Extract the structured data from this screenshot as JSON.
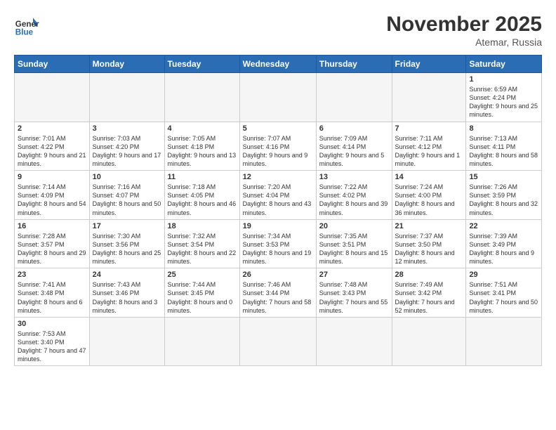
{
  "header": {
    "logo_general": "General",
    "logo_blue": "Blue",
    "month": "November 2025",
    "location": "Atemar, Russia"
  },
  "weekdays": [
    "Sunday",
    "Monday",
    "Tuesday",
    "Wednesday",
    "Thursday",
    "Friday",
    "Saturday"
  ],
  "weeks": [
    [
      {
        "day": "",
        "info": ""
      },
      {
        "day": "",
        "info": ""
      },
      {
        "day": "",
        "info": ""
      },
      {
        "day": "",
        "info": ""
      },
      {
        "day": "",
        "info": ""
      },
      {
        "day": "",
        "info": ""
      },
      {
        "day": "1",
        "info": "Sunrise: 6:59 AM\nSunset: 4:24 PM\nDaylight: 9 hours and 25 minutes."
      }
    ],
    [
      {
        "day": "2",
        "info": "Sunrise: 7:01 AM\nSunset: 4:22 PM\nDaylight: 9 hours and 21 minutes."
      },
      {
        "day": "3",
        "info": "Sunrise: 7:03 AM\nSunset: 4:20 PM\nDaylight: 9 hours and 17 minutes."
      },
      {
        "day": "4",
        "info": "Sunrise: 7:05 AM\nSunset: 4:18 PM\nDaylight: 9 hours and 13 minutes."
      },
      {
        "day": "5",
        "info": "Sunrise: 7:07 AM\nSunset: 4:16 PM\nDaylight: 9 hours and 9 minutes."
      },
      {
        "day": "6",
        "info": "Sunrise: 7:09 AM\nSunset: 4:14 PM\nDaylight: 9 hours and 5 minutes."
      },
      {
        "day": "7",
        "info": "Sunrise: 7:11 AM\nSunset: 4:12 PM\nDaylight: 9 hours and 1 minute."
      },
      {
        "day": "8",
        "info": "Sunrise: 7:13 AM\nSunset: 4:11 PM\nDaylight: 8 hours and 58 minutes."
      }
    ],
    [
      {
        "day": "9",
        "info": "Sunrise: 7:14 AM\nSunset: 4:09 PM\nDaylight: 8 hours and 54 minutes."
      },
      {
        "day": "10",
        "info": "Sunrise: 7:16 AM\nSunset: 4:07 PM\nDaylight: 8 hours and 50 minutes."
      },
      {
        "day": "11",
        "info": "Sunrise: 7:18 AM\nSunset: 4:05 PM\nDaylight: 8 hours and 46 minutes."
      },
      {
        "day": "12",
        "info": "Sunrise: 7:20 AM\nSunset: 4:04 PM\nDaylight: 8 hours and 43 minutes."
      },
      {
        "day": "13",
        "info": "Sunrise: 7:22 AM\nSunset: 4:02 PM\nDaylight: 8 hours and 39 minutes."
      },
      {
        "day": "14",
        "info": "Sunrise: 7:24 AM\nSunset: 4:00 PM\nDaylight: 8 hours and 36 minutes."
      },
      {
        "day": "15",
        "info": "Sunrise: 7:26 AM\nSunset: 3:59 PM\nDaylight: 8 hours and 32 minutes."
      }
    ],
    [
      {
        "day": "16",
        "info": "Sunrise: 7:28 AM\nSunset: 3:57 PM\nDaylight: 8 hours and 29 minutes."
      },
      {
        "day": "17",
        "info": "Sunrise: 7:30 AM\nSunset: 3:56 PM\nDaylight: 8 hours and 25 minutes."
      },
      {
        "day": "18",
        "info": "Sunrise: 7:32 AM\nSunset: 3:54 PM\nDaylight: 8 hours and 22 minutes."
      },
      {
        "day": "19",
        "info": "Sunrise: 7:34 AM\nSunset: 3:53 PM\nDaylight: 8 hours and 19 minutes."
      },
      {
        "day": "20",
        "info": "Sunrise: 7:35 AM\nSunset: 3:51 PM\nDaylight: 8 hours and 15 minutes."
      },
      {
        "day": "21",
        "info": "Sunrise: 7:37 AM\nSunset: 3:50 PM\nDaylight: 8 hours and 12 minutes."
      },
      {
        "day": "22",
        "info": "Sunrise: 7:39 AM\nSunset: 3:49 PM\nDaylight: 8 hours and 9 minutes."
      }
    ],
    [
      {
        "day": "23",
        "info": "Sunrise: 7:41 AM\nSunset: 3:48 PM\nDaylight: 8 hours and 6 minutes."
      },
      {
        "day": "24",
        "info": "Sunrise: 7:43 AM\nSunset: 3:46 PM\nDaylight: 8 hours and 3 minutes."
      },
      {
        "day": "25",
        "info": "Sunrise: 7:44 AM\nSunset: 3:45 PM\nDaylight: 8 hours and 0 minutes."
      },
      {
        "day": "26",
        "info": "Sunrise: 7:46 AM\nSunset: 3:44 PM\nDaylight: 7 hours and 58 minutes."
      },
      {
        "day": "27",
        "info": "Sunrise: 7:48 AM\nSunset: 3:43 PM\nDaylight: 7 hours and 55 minutes."
      },
      {
        "day": "28",
        "info": "Sunrise: 7:49 AM\nSunset: 3:42 PM\nDaylight: 7 hours and 52 minutes."
      },
      {
        "day": "29",
        "info": "Sunrise: 7:51 AM\nSunset: 3:41 PM\nDaylight: 7 hours and 50 minutes."
      }
    ],
    [
      {
        "day": "30",
        "info": "Sunrise: 7:53 AM\nSunset: 3:40 PM\nDaylight: 7 hours and 47 minutes."
      },
      {
        "day": "",
        "info": ""
      },
      {
        "day": "",
        "info": ""
      },
      {
        "day": "",
        "info": ""
      },
      {
        "day": "",
        "info": ""
      },
      {
        "day": "",
        "info": ""
      },
      {
        "day": "",
        "info": ""
      }
    ]
  ]
}
